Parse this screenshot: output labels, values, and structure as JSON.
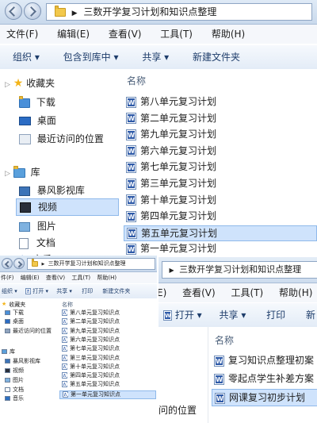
{
  "main_window": {
    "address": {
      "path": "三数开学复习计划和知识点整理"
    },
    "menu": [
      "文件(F)",
      "编辑(E)",
      "查看(V)",
      "工具(T)",
      "帮助(H)"
    ],
    "toolbar": {
      "organize": "组织 ▾",
      "include": "包含到库中 ▾",
      "share": "共享 ▾",
      "new_folder": "新建文件夹"
    },
    "sidebar": [
      {
        "label": "收藏夹",
        "icon": "star-icon"
      },
      {
        "label": "下载",
        "icon": "download-folder-icon"
      },
      {
        "label": "桌面",
        "icon": "desktop-icon"
      },
      {
        "label": "最近访问的位置",
        "icon": "recent-places-icon"
      },
      {
        "label": "库",
        "icon": "library-icon"
      },
      {
        "label": "暴风影视库",
        "icon": "video-library-icon"
      },
      {
        "label": "视频",
        "icon": "video-icon",
        "selected": true
      },
      {
        "label": "图片",
        "icon": "pictures-icon"
      },
      {
        "label": "文档",
        "icon": "documents-icon"
      },
      {
        "label": "音乐",
        "icon": "music-icon"
      }
    ],
    "column_name": "名称",
    "files": [
      "第八单元复习计划",
      "第二单元复习计划",
      "第九单元复习计划",
      "第六单元复习计划",
      "第七单元复习计划",
      "第三单元复习计划",
      "第十单元复习计划",
      "第四单元复习计划",
      "第五单元复习计划",
      "第一单元复习计划"
    ],
    "selected_file": "第五单元复习计划"
  },
  "small_window": {
    "address": {
      "path": "三数开学复习计划和知识点整理"
    },
    "menu": [
      "件(F)",
      "编辑(E)",
      "查看(V)",
      "工具(T)",
      "帮助(H)"
    ],
    "toolbar": {
      "organize": "组织 ▾",
      "open": "打开 ▾",
      "share": "共享 ▾",
      "print": "打印",
      "new_folder": "新建文件夹"
    },
    "sidebar": [
      "收藏夹",
      "下载",
      "桌面",
      "最近访问的位置",
      "库",
      "暴风影视库",
      "视频",
      "图片",
      "文档",
      "音乐"
    ],
    "column_name": "名称",
    "files": [
      "第八单元复习知识点",
      "第二单元复习知识点",
      "第九单元复习知识点",
      "第六单元复习知识点",
      "第七单元复习知识点",
      "第三单元复习知识点",
      "第十单元复习知识点",
      "第四单元复习知识点",
      "第五单元复习知识点",
      "第一单元复习知识点"
    ],
    "selected_file": "第一单元复习知识点"
  },
  "zoom_window": {
    "address": {
      "path": "三数开学复习计划和知识点整理"
    },
    "menu": [
      "E)",
      "查看(V)",
      "工具(T)",
      "帮助(H)"
    ],
    "toolbar": {
      "open": "打开 ▾",
      "share": "共享 ▾",
      "print": "打印",
      "new_folder": "新"
    },
    "column_name": "名称",
    "sidebar_fragment": "问的位置",
    "files": [
      "复习知识点整理初案",
      "零起点学生补差方案",
      "网课复习初步计划"
    ],
    "selected_file": "网课复习初步计划"
  }
}
